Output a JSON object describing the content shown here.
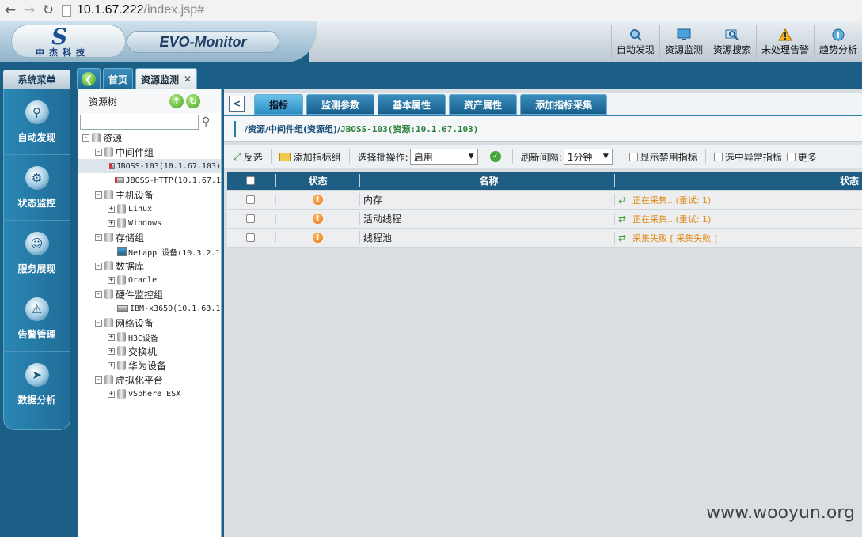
{
  "browser": {
    "host": "10.1.67.222",
    "path": "/index.jsp#"
  },
  "header": {
    "logo_letter": "S",
    "logo_cn": "中杰科技",
    "app_title": "EVO-Monitor",
    "nav": [
      {
        "label": "自动发现",
        "icon": "magnifier-icon"
      },
      {
        "label": "资源监测",
        "icon": "monitor-icon"
      },
      {
        "label": "资源搜索",
        "icon": "search-screen-icon"
      },
      {
        "label": "未处理告警",
        "icon": "warning-icon"
      },
      {
        "label": "趋势分析",
        "icon": "trend-icon"
      }
    ]
  },
  "sidebar": {
    "title": "系统菜单",
    "items": [
      {
        "label": "自动发现"
      },
      {
        "label": "状态监控"
      },
      {
        "label": "服务展现"
      },
      {
        "label": "告警管理"
      },
      {
        "label": "数据分析"
      }
    ]
  },
  "tabs": {
    "home": "首页",
    "active": "资源监测"
  },
  "tree": {
    "title": "资源树",
    "nodes": [
      {
        "label": "资源",
        "level": 0,
        "kind": "db",
        "exp": "-"
      },
      {
        "label": "中间件组",
        "level": 1,
        "kind": "db",
        "exp": "-"
      },
      {
        "label": "JBOSS-103(10.1.67.103)",
        "level": 2,
        "kind": "leaf-red",
        "exp": ""
      },
      {
        "label": "JBOSS-HTTP(10.1.67.1",
        "level": 2,
        "kind": "leaf-red",
        "exp": ""
      },
      {
        "label": "主机设备",
        "level": 1,
        "kind": "db",
        "exp": "-"
      },
      {
        "label": "Linux",
        "level": 2,
        "kind": "db",
        "exp": "+"
      },
      {
        "label": "Windows",
        "level": 2,
        "kind": "db",
        "exp": "+"
      },
      {
        "label": "存储组",
        "level": 1,
        "kind": "db",
        "exp": "-"
      },
      {
        "label": "Netapp 设备(10.3.2.1",
        "level": 2,
        "kind": "leaf-blue",
        "exp": ""
      },
      {
        "label": "数据库",
        "level": 1,
        "kind": "db",
        "exp": "-"
      },
      {
        "label": "Oracle",
        "level": 2,
        "kind": "db",
        "exp": "+"
      },
      {
        "label": "硬件监控组",
        "level": 1,
        "kind": "db",
        "exp": "-"
      },
      {
        "label": "IBM-x3650(10.1.63.1",
        "level": 2,
        "kind": "leaf",
        "exp": ""
      },
      {
        "label": "网络设备",
        "level": 1,
        "kind": "db",
        "exp": "-"
      },
      {
        "label": "H3C设备",
        "level": 2,
        "kind": "db",
        "exp": "+"
      },
      {
        "label": "交换机",
        "level": 2,
        "kind": "db",
        "exp": "+"
      },
      {
        "label": "华为设备",
        "level": 2,
        "kind": "db",
        "exp": "+"
      },
      {
        "label": "虚拟化平台",
        "level": 1,
        "kind": "db",
        "exp": "-"
      },
      {
        "label": "vSphere ESX",
        "level": 2,
        "kind": "db",
        "exp": "+"
      }
    ]
  },
  "content": {
    "tabs": [
      "指标",
      "监测参数",
      "基本属性",
      "资产属性",
      "添加指标采集"
    ],
    "breadcrumb": {
      "path": "/资源/中间件组(资源组)/",
      "current": "JBOSS-103(资源:10.1.67.103)"
    },
    "toolbar": {
      "invert": "反选",
      "add_group": "添加指标组",
      "batch_label": "选择批操作:",
      "batch_value": "启用",
      "refresh_label": "刷新间隔:",
      "refresh_value": "1分钟",
      "show_disabled": "显示禁用指标",
      "select_abnormal": "选中异常指标",
      "more": "更多"
    },
    "grid": {
      "headers": [
        "状态",
        "名称",
        "状态"
      ],
      "rows": [
        {
          "name": "内存",
          "status": "正在采集...(重试: 1)"
        },
        {
          "name": "活动线程",
          "status": "正在采集...(重试: 1)"
        },
        {
          "name": "线程池",
          "status": "采集失败 [ 采集失败 ]"
        }
      ]
    }
  },
  "watermark": "www.wooyun.org"
}
